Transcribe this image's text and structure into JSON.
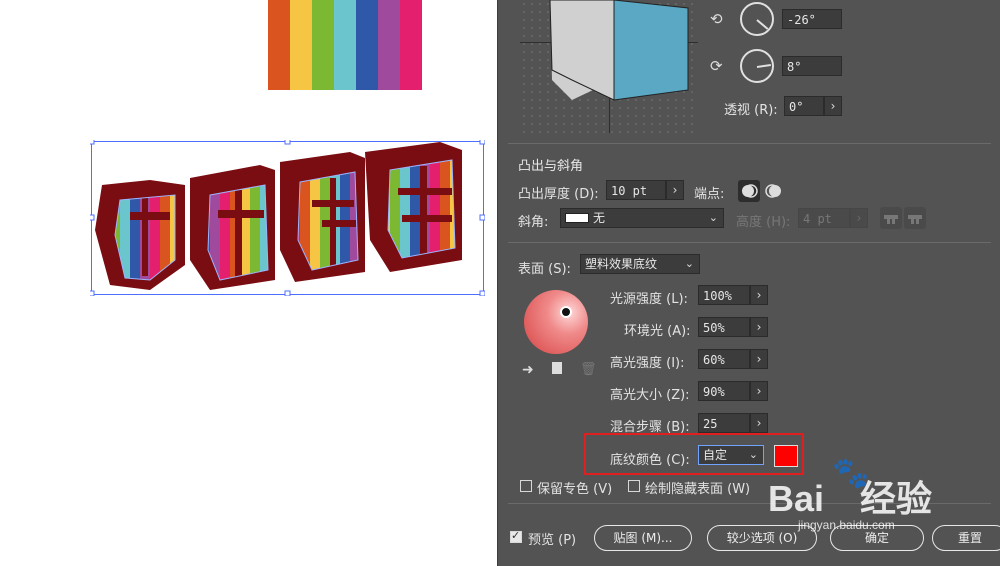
{
  "canvas": {
    "stripe_colors": [
      "#d9541e",
      "#f6c544",
      "#7cb832",
      "#6ac5cc",
      "#2f59a8",
      "#a04a9e",
      "#e4206e"
    ],
    "art_text": "节日快乐"
  },
  "dialog": {
    "rotation": {
      "angle_y_value": "-26°",
      "angle_z_value": "8°",
      "perspective_label": "透视 (R):",
      "perspective_value": "0°"
    },
    "extrude": {
      "title": "凸出与斜角",
      "depth_label": "凸出厚度 (D):",
      "depth_value": "10 pt",
      "cap_label": "端点:",
      "bevel_label": "斜角:",
      "bevel_value": "无",
      "height_label": "高度 (H):",
      "height_value": "4 pt"
    },
    "surface": {
      "label": "表面 (S):",
      "value": "塑料效果底纹",
      "light_intensity_label": "光源强度 (L):",
      "light_intensity_value": "100%",
      "ambient_label": "环境光 (A):",
      "ambient_value": "50%",
      "highlight_intensity_label": "高光强度 (I):",
      "highlight_intensity_value": "60%",
      "highlight_size_label": "高光大小 (Z):",
      "highlight_size_value": "90%",
      "blend_steps_label": "混合步骤 (B):",
      "blend_steps_value": "25",
      "shading_color_label": "底纹颜色 (C):",
      "shading_color_value": "自定",
      "shading_swatch_color": "#ff0000",
      "preserve_spot_label": "保留专色 (V)",
      "draw_hidden_label": "绘制隐藏表面 (W)"
    },
    "footer": {
      "preview_label": "预览 (P)",
      "map_art_label": "贴图 (M)...",
      "fewer_options_label": "较少选项 (O)",
      "ok_label": "确定",
      "reset_label": "重置"
    }
  },
  "watermark": {
    "brand": "Bai",
    "brand2": "经验",
    "url": "jingyan.baidu.com"
  }
}
